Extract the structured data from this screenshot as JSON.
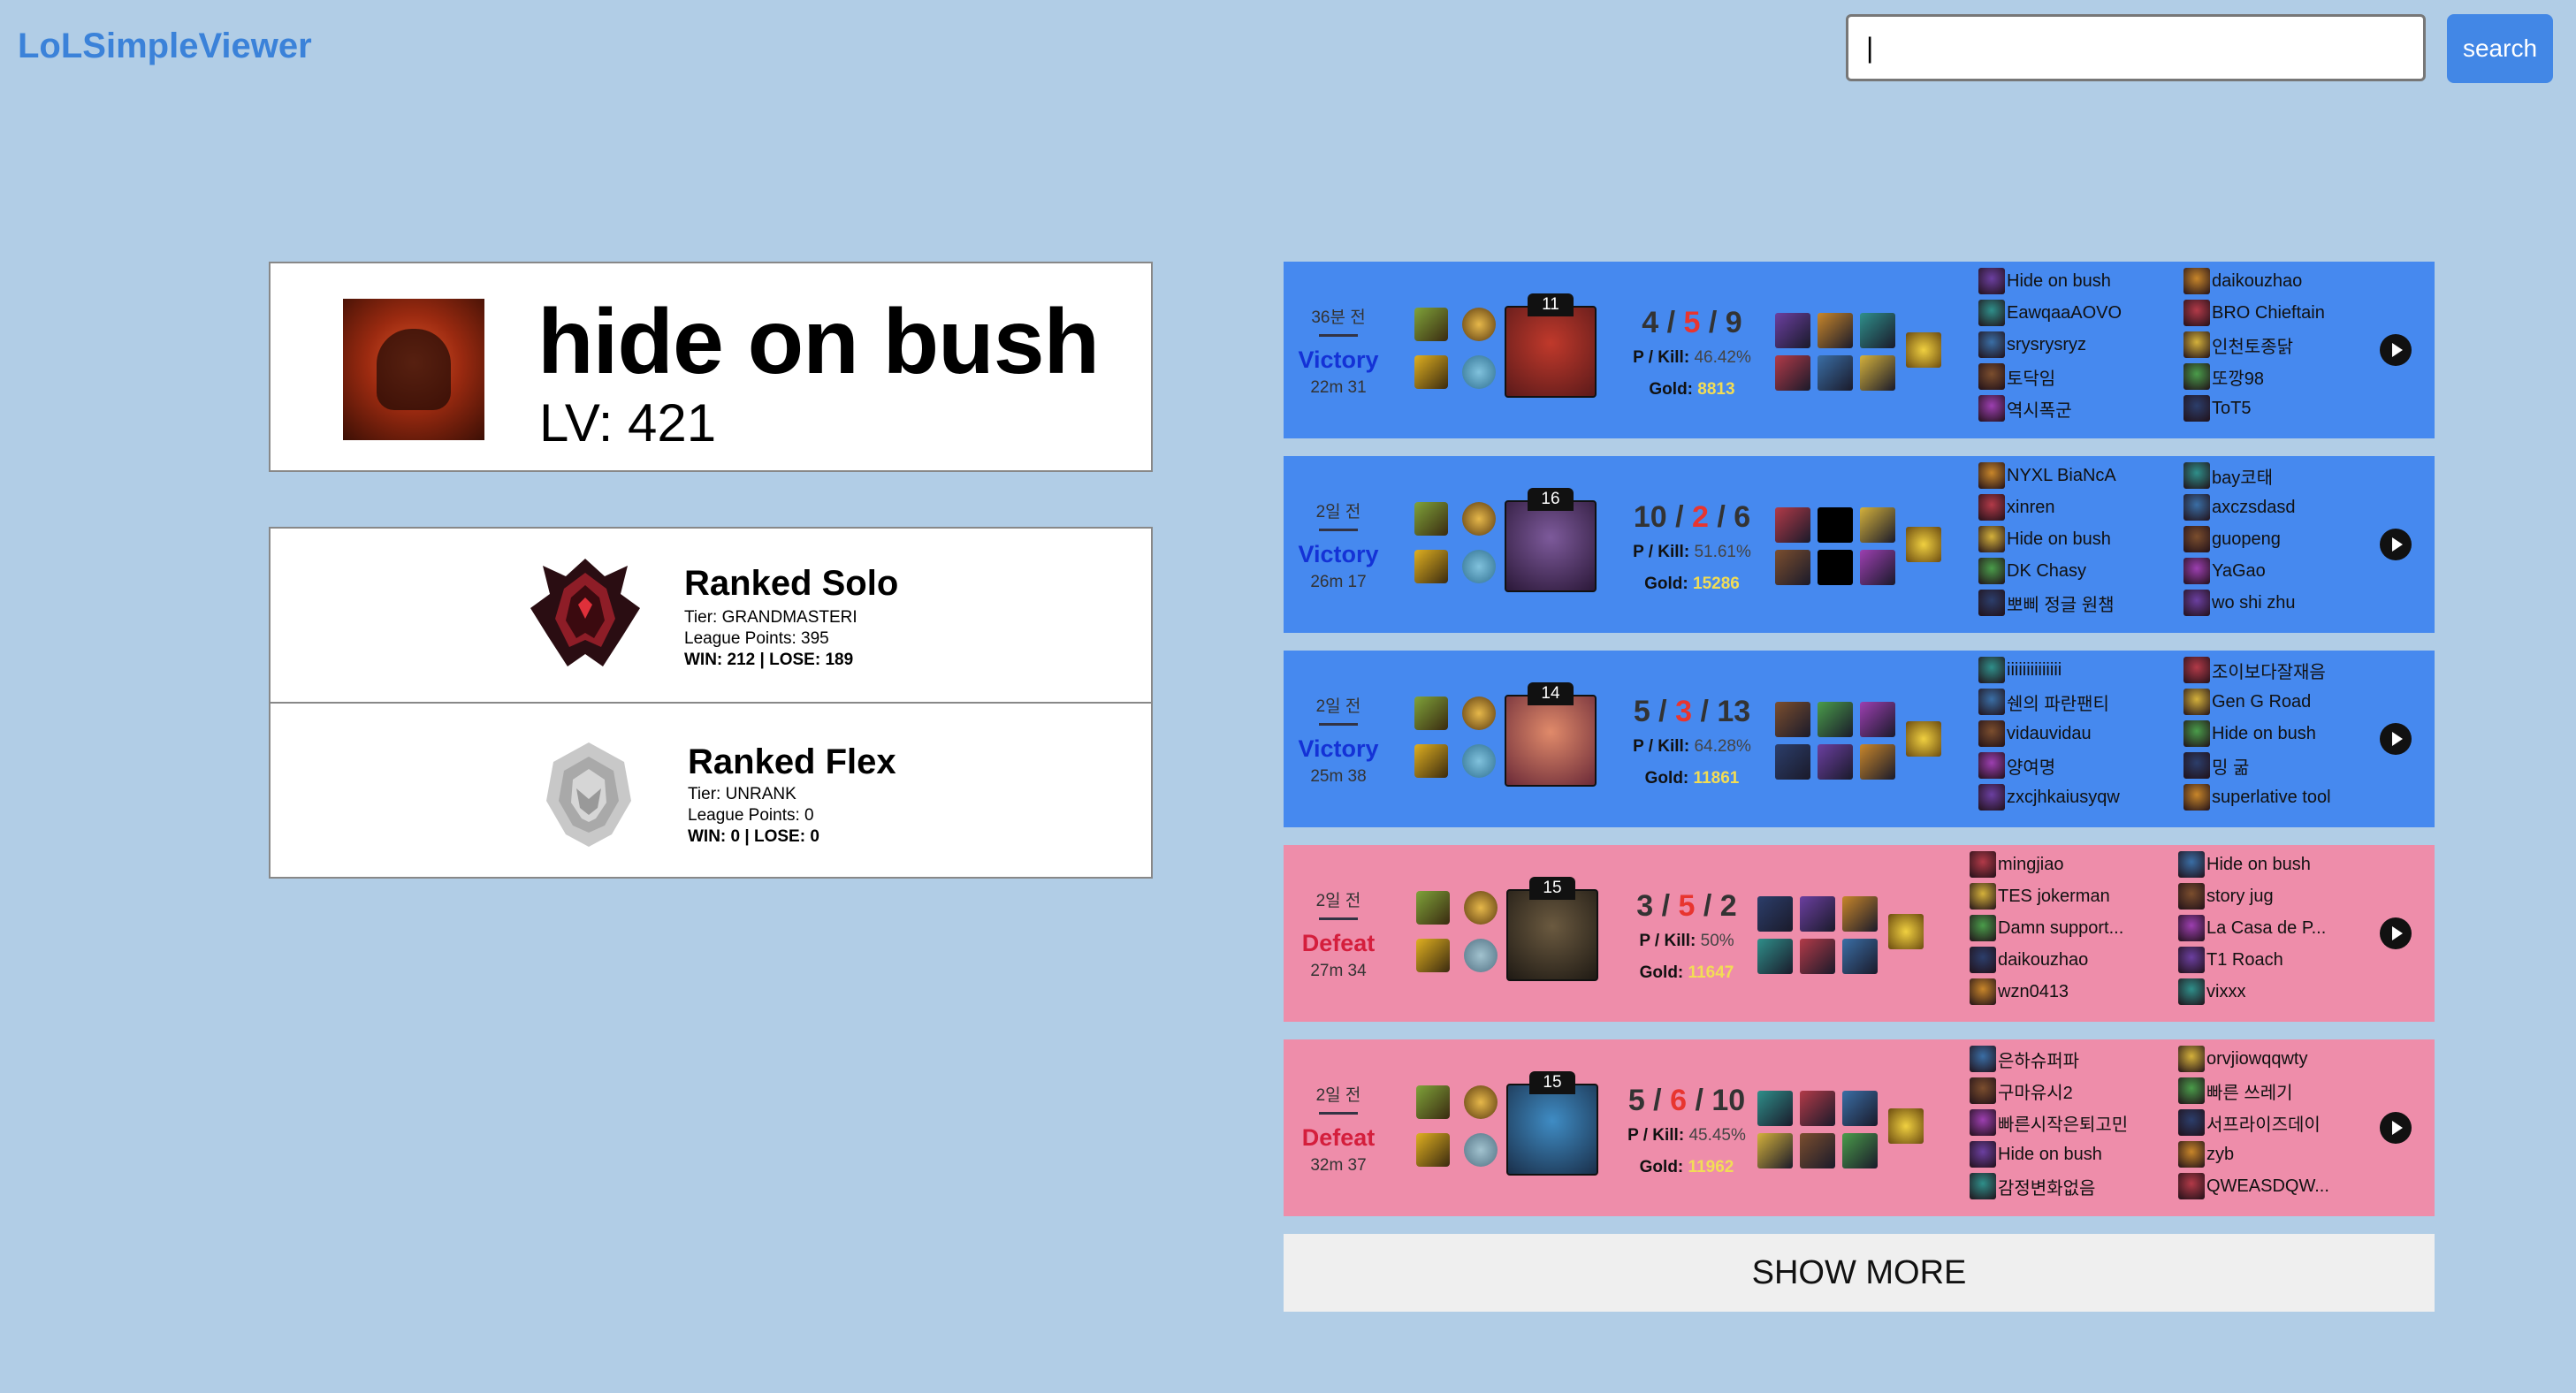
{
  "header": {
    "logo": "LoLSimpleViewer",
    "search_value": "|",
    "search_label": "search"
  },
  "profile": {
    "name": "hide on bush",
    "level": "LV: 421"
  },
  "ranks": [
    {
      "title": "Ranked Solo",
      "tier": "Tier: GRANDMASTERI",
      "lp": "League Points: 395",
      "wl": "WIN: 212 | LOSE: 189"
    },
    {
      "title": "Ranked Flex",
      "tier": "Tier: UNRANK",
      "lp": "League Points: 0",
      "wl": "WIN: 0 | LOSE: 0"
    }
  ],
  "matches": [
    {
      "ago": "36분 전",
      "result": "Victory",
      "duration": "22m 31",
      "level": "11",
      "k": "4",
      "d": "5",
      "a": "9",
      "pkill_label": "P / Kill:",
      "pkill": "46.42%",
      "gold_label": "Gold:",
      "gold": "8813",
      "team1": [
        "Hide on bush",
        "EawqaaAOVO",
        "srysrysryz",
        "토닥임",
        "역시폭군"
      ],
      "team2": [
        "daikouzhao",
        "BRO Chieftain",
        "인천토종닭",
        "또깡98",
        "ToT5"
      ]
    },
    {
      "ago": "2일 전",
      "result": "Victory",
      "duration": "26m 17",
      "level": "16",
      "k": "10",
      "d": "2",
      "a": "6",
      "pkill_label": "P / Kill:",
      "pkill": "51.61%",
      "gold_label": "Gold:",
      "gold": "15286",
      "team1": [
        "NYXL BiaNcA",
        "xinren",
        "Hide on bush",
        "DK Chasy",
        "뽀삐 정글 원챔"
      ],
      "team2": [
        "bay코태",
        "axczsdasd",
        "guopeng",
        "YaGao",
        "wo shi zhu"
      ]
    },
    {
      "ago": "2일 전",
      "result": "Victory",
      "duration": "25m 38",
      "level": "14",
      "k": "5",
      "d": "3",
      "a": "13",
      "pkill_label": "P / Kill:",
      "pkill": "64.28%",
      "gold_label": "Gold:",
      "gold": "11861",
      "team1": [
        "iiiiiiiiiiiiii",
        "쉔의 파란팬티",
        "vidauvidau",
        "양여명",
        "zxcjhkaiusyqw"
      ],
      "team2": [
        "조이보다잘재음",
        "Gen G Road",
        "Hide on bush",
        "밍 굶",
        "superlative tool"
      ]
    },
    {
      "ago": "2일 전",
      "result": "Defeat",
      "duration": "27m 34",
      "level": "15",
      "k": "3",
      "d": "5",
      "a": "2",
      "pkill_label": "P / Kill:",
      "pkill": "50%",
      "gold_label": "Gold:",
      "gold": "11647",
      "team1": [
        "mingjiao",
        "TES jokerman",
        "Damn support...",
        "daikouzhao",
        "wzn0413"
      ],
      "team2": [
        "Hide on bush",
        "story jug",
        "La Casa de P...",
        "T1 Roach",
        "vixxx"
      ]
    },
    {
      "ago": "2일 전",
      "result": "Defeat",
      "duration": "32m 37",
      "level": "15",
      "k": "5",
      "d": "6",
      "a": "10",
      "pkill_label": "P / Kill:",
      "pkill": "45.45%",
      "gold_label": "Gold:",
      "gold": "11962",
      "team1": [
        "은하슈퍼파",
        "구마유시2",
        "빠른시작은퇴고민",
        "Hide on bush",
        "감정변화없음"
      ],
      "team2": [
        "orvjiowqqwty",
        "빠른 쓰레기",
        "서프라이즈데이",
        "zyb",
        "QWEASDQW..."
      ]
    }
  ],
  "show_more": "SHOW MORE",
  "colors": {
    "background": "#b1cde6",
    "victory": "#4689ef",
    "defeat": "#ee8daa",
    "deaths": "#e8352f",
    "gold": "#f2dd55",
    "logo": "#3b82d9"
  }
}
